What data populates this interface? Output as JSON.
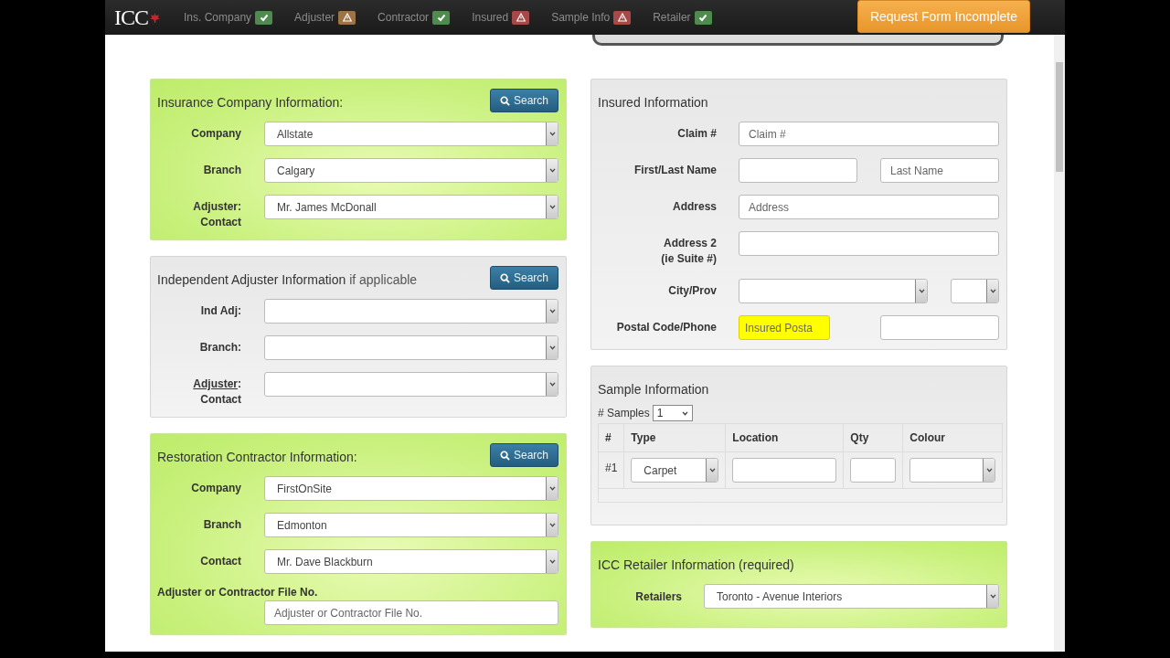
{
  "logo": "ICC",
  "nav": [
    {
      "label": "Ins. Company",
      "kind": "ok",
      "color": "#4f8a4f"
    },
    {
      "label": "Adjuster",
      "kind": "warn",
      "color": "#9c7446"
    },
    {
      "label": "Contractor",
      "kind": "ok",
      "color": "#4f8a4f"
    },
    {
      "label": "Insured",
      "kind": "warn",
      "color": "#a84848"
    },
    {
      "label": "Sample Info",
      "kind": "warn",
      "color": "#a84848"
    },
    {
      "label": "Retailer",
      "kind": "ok",
      "color": "#4f8a4f"
    }
  ],
  "request_button": "Request Form Incomplete",
  "left_panels": [
    {
      "title": "Insurance Company Information:",
      "complete": true,
      "search": "Search",
      "fields": [
        {
          "kind": "select",
          "label": "Company",
          "underlined": false,
          "value": "Allstate"
        },
        {
          "kind": "select",
          "label": "Branch",
          "underlined": false,
          "value": "Calgary"
        },
        {
          "kind": "select",
          "label": "Adjuster:",
          "label_2": "Contact",
          "underlined": false,
          "value": "Mr. James McDonall"
        }
      ]
    },
    {
      "title": "Independent Adjuster Information",
      "title_suffix": "if applicable",
      "complete": false,
      "search": "Search",
      "fields": [
        {
          "kind": "select",
          "label": "Ind Adj:",
          "underlined": false
        },
        {
          "kind": "select",
          "label": "Branch:",
          "underlined": false
        },
        {
          "kind": "select",
          "label": "Adjuster",
          "label_suffix": ":",
          "label_2": "Contact",
          "underlined": true
        }
      ]
    },
    {
      "title": "Restoration Contractor Information:",
      "complete": true,
      "search": "Search",
      "fields": [
        {
          "kind": "select",
          "label": "Company",
          "underlined": false,
          "value": "FirstOnSite"
        },
        {
          "kind": "select",
          "label": "Branch",
          "underlined": false,
          "value": "Edmonton"
        },
        {
          "kind": "select",
          "label": "Contact",
          "underlined": false,
          "value": "Mr. Dave Blackburn"
        },
        {
          "kind": "input-below",
          "label": "Adjuster or Contractor File No.",
          "underlined": false,
          "placeholder": "Adjuster or Contractor File No."
        }
      ]
    }
  ],
  "insured": {
    "title": "Insured Information",
    "complete": false,
    "rows": [
      {
        "label": "Claim #",
        "controls": [
          {
            "kind": "input",
            "placeholder": "Claim #",
            "highlighted": false
          }
        ]
      },
      {
        "label": "First/Last Name",
        "controls": [
          {
            "kind": "input",
            "highlighted": false
          },
          {
            "kind": "input",
            "placeholder": "Last Name",
            "highlighted": false
          }
        ]
      },
      {
        "label": "Address",
        "controls": [
          {
            "kind": "input",
            "placeholder": "Address",
            "highlighted": false
          }
        ]
      },
      {
        "label": "Address 2",
        "label_2": "(ie Suite #)",
        "controls": [
          {
            "kind": "input",
            "highlighted": false
          }
        ]
      },
      {
        "label": "City/Prov",
        "controls": [
          {
            "kind": "select",
            "highlighted": false
          },
          {
            "kind": "select-narrow",
            "highlighted": false
          }
        ]
      },
      {
        "label": "Postal Code/Phone",
        "controls": [
          {
            "kind": "input-short",
            "placeholder": "Insured Posta",
            "highlighted": true
          },
          {
            "kind": "input",
            "highlighted": false
          }
        ]
      }
    ]
  },
  "sample": {
    "title": "Sample Information",
    "complete": false,
    "count_label": "# Samples",
    "count": "1",
    "columns": [
      "#",
      "Type",
      "Location",
      "Qty",
      "Colour"
    ],
    "rows": [
      {
        "number": "#1",
        "type": "Carpet"
      }
    ]
  },
  "retailer": {
    "title": "ICC Retailer Information (required)",
    "complete": true,
    "label": "Retailers",
    "value": "Toronto - Avenue Interiors"
  }
}
